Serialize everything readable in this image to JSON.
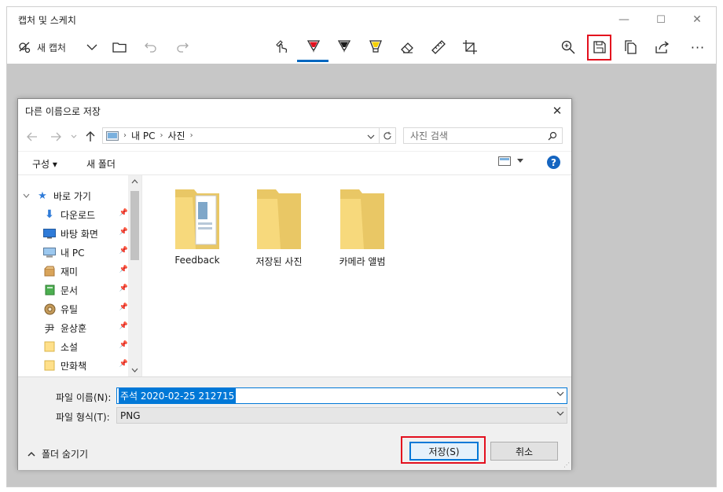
{
  "app": {
    "title": "캡처 및 스케치",
    "window_controls": {
      "minimize": "—",
      "maximize": "☐",
      "close": "✕"
    }
  },
  "toolbar": {
    "new_capture_label": "새 캡처",
    "more_label": "···",
    "icons": [
      "snip-new-icon",
      "chevron-down-icon",
      "open-folder-icon",
      "undo-icon",
      "redo-icon",
      "touch-writing-icon",
      "ballpoint-pen-icon",
      "pencil-icon",
      "highlighter-icon",
      "eraser-icon",
      "ruler-icon",
      "crop-icon",
      "zoom-icon",
      "save-icon",
      "copy-icon",
      "share-icon",
      "more-icon"
    ],
    "pen_color": "#e3101e",
    "highlighter_color": "#f5d000",
    "highlight_box_color": "#e3101e"
  },
  "dialog": {
    "title": "다른 이름으로 저장",
    "breadcrumb": [
      "내 PC",
      "사진"
    ],
    "search_placeholder": "사진 검색",
    "organize_label": "구성 ▾",
    "new_folder_label": "새 폴더",
    "help_label": "?",
    "nav_items": [
      {
        "label": "바로 가기",
        "icon": "star-icon"
      },
      {
        "label": "다운로드",
        "icon": "download-icon"
      },
      {
        "label": "바탕 화면",
        "icon": "desktop-icon"
      },
      {
        "label": "내 PC",
        "icon": "computer-icon"
      },
      {
        "label": "재미",
        "icon": "box-icon"
      },
      {
        "label": "문서",
        "icon": "book-icon"
      },
      {
        "label": "유틸",
        "icon": "gear-icon"
      },
      {
        "label": "윤상훈",
        "icon": "user-folder-icon"
      },
      {
        "label": "소설",
        "icon": "folder-icon"
      },
      {
        "label": "만화책",
        "icon": "folder-icon"
      }
    ],
    "folders": [
      {
        "label": "Feedback"
      },
      {
        "label": "저장된 사진"
      },
      {
        "label": "카메라 앨범"
      }
    ],
    "file_name_label": "파일 이름(N):",
    "file_name_value": "주석 2020-02-25 212715",
    "file_type_label": "파일 형식(T):",
    "file_type_value": "PNG",
    "hide_folders_label": "폴더 숨기기",
    "save_button": "저장(S)",
    "cancel_button": "취소",
    "accent_color": "#0078d7"
  }
}
